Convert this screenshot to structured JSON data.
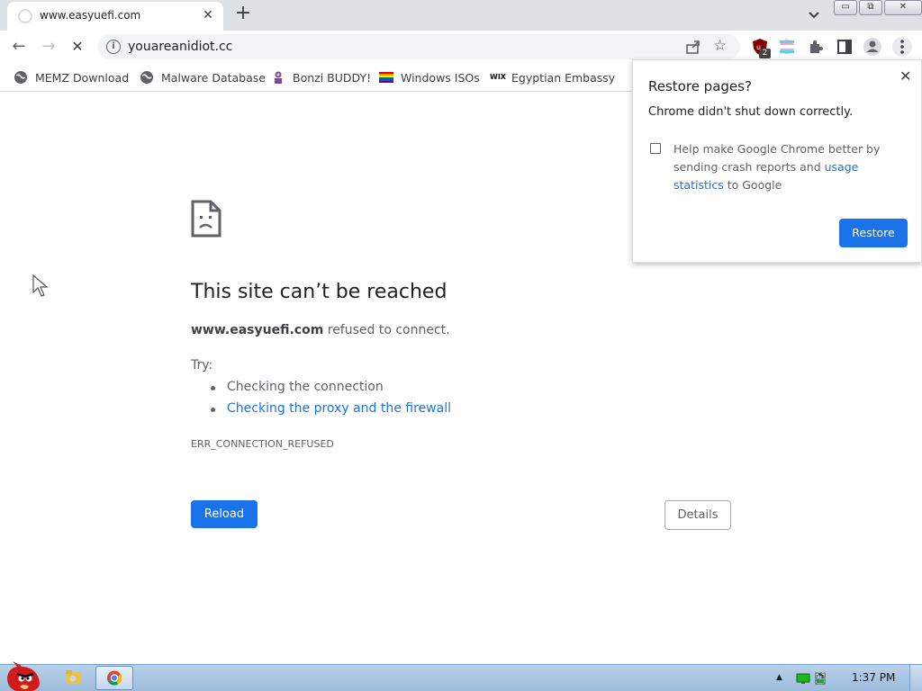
{
  "tab": {
    "title": "www.easyuefi.com",
    "close": "✕"
  },
  "newtab": "+",
  "window_buttons": {
    "minimize": "▭",
    "restore": "⧉",
    "close": "✕"
  },
  "toolbar": {
    "back": "←",
    "forward": "→",
    "stop": "✕",
    "info": "i",
    "url": "youareanidiot.cc",
    "star": "☆",
    "ext_badge": "2"
  },
  "bookmarks": [
    {
      "label": "MEMZ Download",
      "icon": "globe-icon"
    },
    {
      "label": "Malware Database",
      "icon": "globe-icon"
    },
    {
      "label": "Bonzi BUDDY!",
      "icon": "bonzi-icon"
    },
    {
      "label": "Windows ISOs",
      "icon": "rainbow-flag-icon"
    },
    {
      "label": "Egyptian Embassy",
      "icon": "wix-icon"
    }
  ],
  "wix_text": "WIX",
  "error": {
    "title": "This site can’t be reached",
    "host": "www.easyuefi.com",
    "desc_rest": " refused to connect.",
    "try": "Try:",
    "suggestions": [
      "Checking the connection",
      "Checking the proxy and the firewall"
    ],
    "code": "ERR_CONNECTION_REFUSED",
    "reload": "Reload",
    "details": "Details"
  },
  "popup": {
    "title": "Restore pages?",
    "close": "✕",
    "subtitle": "Chrome didn't shut down correctly.",
    "checkbox_text_a": "Help make Google Chrome better by sending crash reports and ",
    "checkbox_link": "usage statistics",
    "checkbox_text_b": " to Google",
    "restore": "Restore"
  },
  "taskbar": {
    "clock": "1:37 PM",
    "tray_up": "▲",
    "volume": "🔊"
  },
  "colors": {
    "accent": "#1a73e8",
    "tabstrip": "#dee1e6",
    "taskbar": "#b9d1ea"
  }
}
